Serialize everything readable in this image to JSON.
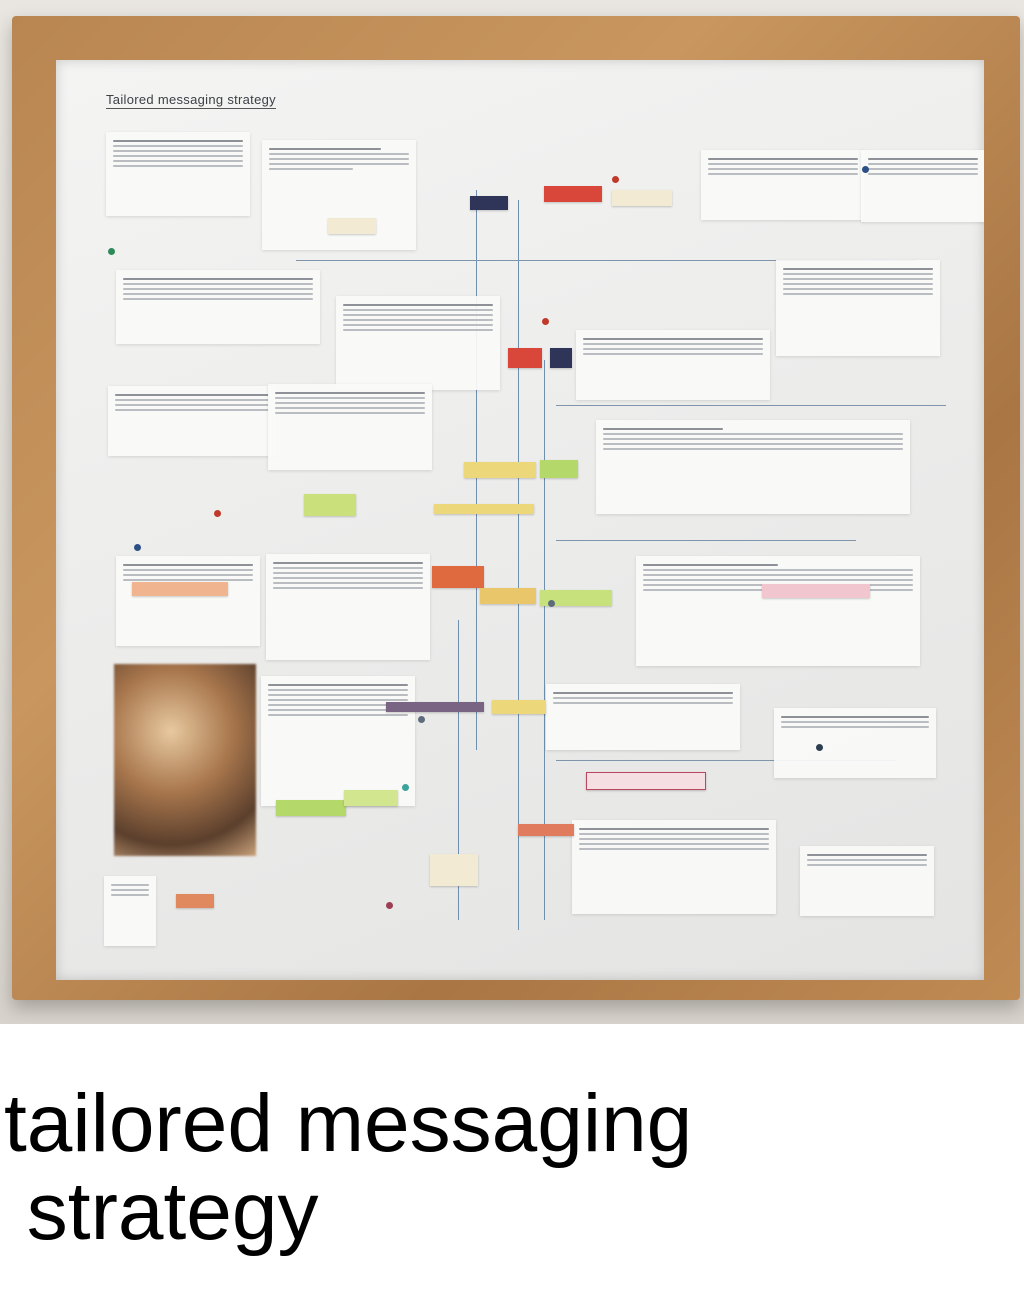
{
  "board": {
    "title": "Tailored messaging strategy"
  },
  "caption": {
    "line1": "tailored messaging",
    "line2": " strategy"
  },
  "colors": {
    "frame": "#b98652",
    "glass": "#efefee",
    "tag_red": "#d8473a",
    "tag_green": "#b5d86a",
    "tag_yellow": "#ecd77a",
    "tag_navy": "#2f3559",
    "line_blue": "#6f8fb0"
  }
}
